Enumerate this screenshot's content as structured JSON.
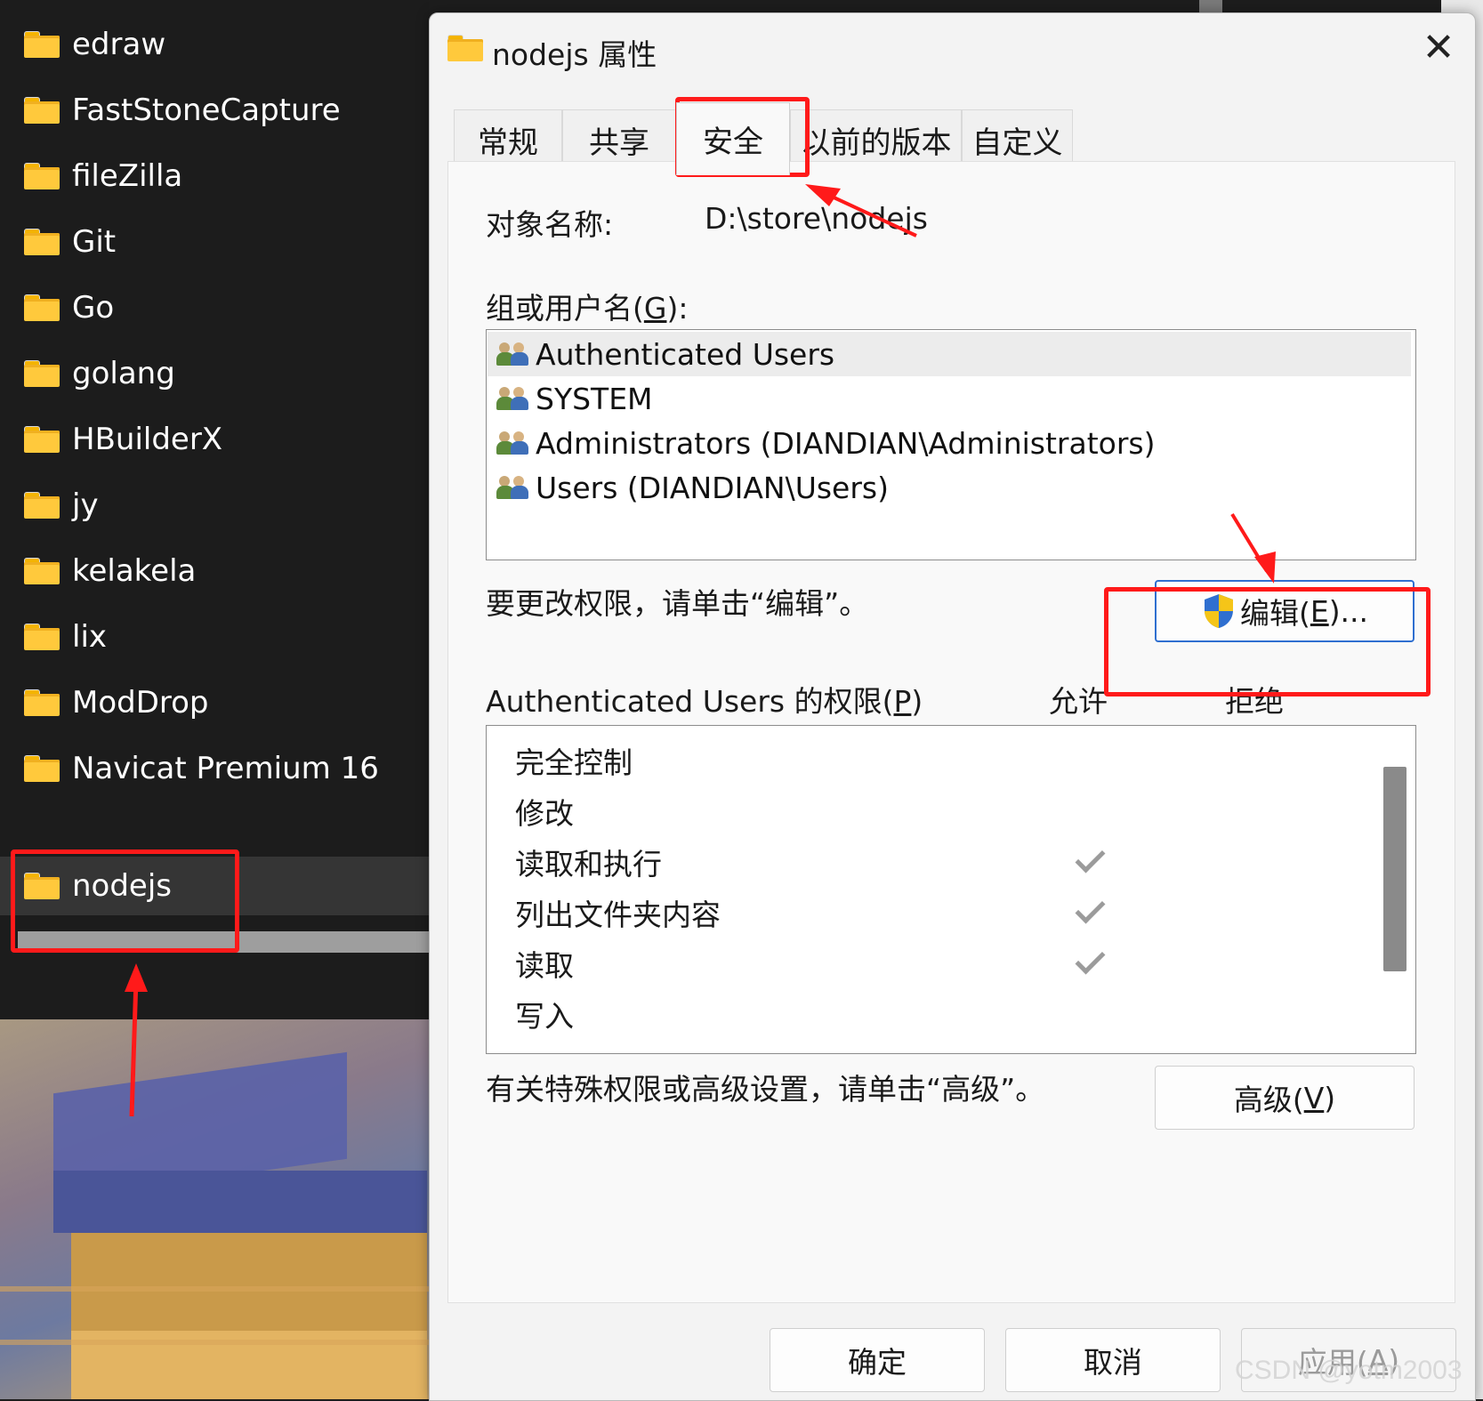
{
  "explorer": {
    "folders": [
      "edraw",
      "FastStoneCapture",
      "fileZilla",
      "Git",
      "Go",
      "golang",
      "HBuilderX",
      "jy",
      "kelakela",
      "lix",
      "ModDrop",
      "Navicat Premium 16",
      "nodejs"
    ],
    "selected": "nodejs"
  },
  "dialog": {
    "title": "nodejs 属性",
    "close_glyph": "✕",
    "tabs": [
      {
        "label": "常规",
        "active": false
      },
      {
        "label": "共享",
        "active": false
      },
      {
        "label": "安全",
        "active": true
      },
      {
        "label": "以前的版本",
        "active": false
      },
      {
        "label": "自定义",
        "active": false
      }
    ],
    "security": {
      "object_name_label": "对象名称:",
      "object_name_value": "D:\\store\\nodejs",
      "groups_label_pre": "组或用户名(",
      "groups_label_key": "G",
      "groups_label_post": "):",
      "users": [
        "Authenticated Users",
        "SYSTEM",
        "Administrators (DIANDIAN\\Administrators)",
        "Users (DIANDIAN\\Users)"
      ],
      "selected_user_index": 0,
      "edit_hint": "要更改权限，请单击“编辑”。",
      "edit_button_pre": "编辑(",
      "edit_button_key": "E",
      "edit_button_post": ")...",
      "perm_label_pre": "Authenticated Users 的权限(",
      "perm_label_key": "P",
      "perm_label_post": ")",
      "allow_header": "允许",
      "deny_header": "拒绝",
      "permissions": [
        {
          "name": "完全控制",
          "allow": false,
          "deny": false
        },
        {
          "name": "修改",
          "allow": false,
          "deny": false
        },
        {
          "name": "读取和执行",
          "allow": true,
          "deny": false
        },
        {
          "name": "列出文件夹内容",
          "allow": true,
          "deny": false
        },
        {
          "name": "读取",
          "allow": true,
          "deny": false
        },
        {
          "name": "写入",
          "allow": false,
          "deny": false
        }
      ],
      "advanced_hint": "有关特殊权限或高级设置，请单击“高级”。",
      "advanced_button_pre": "高级(",
      "advanced_button_key": "V",
      "advanced_button_post": ")"
    },
    "footer": {
      "ok": "确定",
      "cancel": "取消",
      "apply_pre": "应用(",
      "apply_key": "A",
      "apply_post": ")"
    }
  },
  "watermark": "CSDN @yotm2003",
  "colors": {
    "annotation_red": "#ff1a1a",
    "folder_yellow": "#ffc93c",
    "focus_blue": "#2f6fd0"
  }
}
